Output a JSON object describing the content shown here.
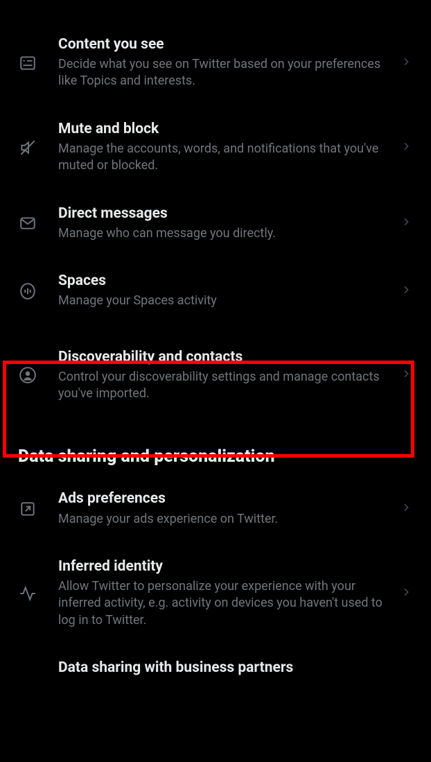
{
  "items": [
    {
      "title": "Content you see",
      "sub": "Decide what you see on Twitter based on your preferences like Topics and interests."
    },
    {
      "title": "Mute and block",
      "sub": "Manage the accounts, words, and notifications that you've muted or blocked."
    },
    {
      "title": "Direct messages",
      "sub": "Manage who can message you directly."
    },
    {
      "title": "Spaces",
      "sub": "Manage your Spaces activity"
    },
    {
      "title": "Discoverability and contacts",
      "sub": "Control your discoverability settings and manage contacts you've imported."
    }
  ],
  "section_header": "Data sharing and personalization",
  "items2": [
    {
      "title": "Ads preferences",
      "sub": "Manage your ads experience on Twitter."
    },
    {
      "title": "Inferred identity",
      "sub": "Allow Twitter to personalize your experience with your inferred activity, e.g. activity on devices you haven't used to log in to Twitter."
    },
    {
      "title": "Data sharing with business partners",
      "sub": ""
    }
  ]
}
